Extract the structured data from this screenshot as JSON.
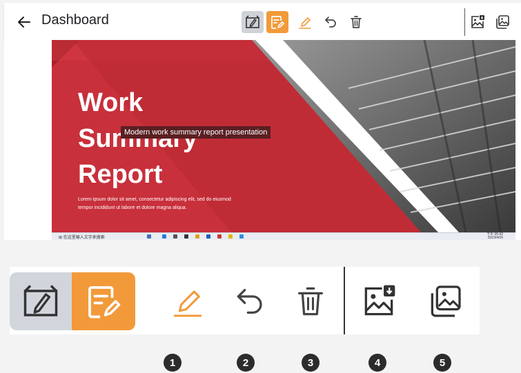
{
  "header": {
    "title": "Dashboard",
    "back_icon": "arrow-left-icon",
    "toolbar": [
      "draw-mode-icon",
      "notes-edit-icon",
      "pen-icon",
      "undo-icon",
      "trash-icon",
      "export-image-icon",
      "gallery-icon"
    ]
  },
  "slide": {
    "title_line1": "Work",
    "title_line2": "Summary",
    "title_line3": "Report",
    "body_line1": "Lorem ipsum dolor sit amet, consectetur adipiscing elit, sed do eiusmod",
    "body_line2": "tempor incididunt ut labore et dolore magna aliqua.",
    "tooltip": "Modern work summary report presentation"
  },
  "taskbar": {
    "search": "在这里输入文字来搜索",
    "time": "下午 05:42",
    "date": "2023/4/26"
  },
  "legend": {
    "numbers": [
      "1",
      "2",
      "3",
      "4",
      "5"
    ]
  },
  "colors": {
    "accent": "#f29a3a",
    "slide_red": "#c8303b",
    "active_grey": "#cfd3d8"
  }
}
